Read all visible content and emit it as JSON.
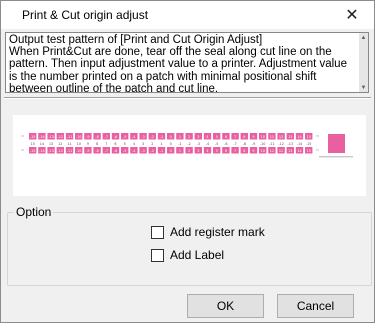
{
  "window": {
    "title": "Print & Cut origin adjust"
  },
  "description": {
    "text": "Output test pattern of [Print and Cut Origin Adjust]\nWhen Print&Cut are done, tear off the seal along cut line on the pattern. Then input adjustment value to a printer. Adjustment value is the number printed on a patch with minimal positional shift between outline of the patch and cut line."
  },
  "preview": {
    "row1_numbers": [
      "-15",
      "-14",
      "-13",
      "-12",
      "-11",
      "-10",
      "-9",
      "-8",
      "-7",
      "-6",
      "-5",
      "-4",
      "-3",
      "-2",
      "-1",
      "0",
      "1",
      "2",
      "3",
      "4",
      "5",
      "6",
      "7",
      "8",
      "9",
      "10",
      "11",
      "12",
      "13",
      "14",
      "15"
    ],
    "row2_numbers": [
      "-15",
      "-14",
      "-13",
      "-12",
      "-11",
      "-10",
      "-9",
      "-8",
      "-7",
      "-6",
      "-5",
      "-4",
      "-3",
      "-2",
      "-1",
      "0",
      "1",
      "2",
      "3",
      "4",
      "5",
      "6",
      "7",
      "8",
      "9",
      "10",
      "11",
      "12",
      "13",
      "14",
      "15"
    ],
    "mid_labels": [
      "15",
      "14",
      "13",
      "12",
      "11",
      "10",
      "9",
      "8",
      "7",
      "6",
      "5",
      "4",
      "3",
      "2",
      "1",
      "0",
      "-1",
      "-2",
      "-3",
      "-4",
      "-5",
      "-6",
      "-7",
      "-8",
      "-9",
      "-10",
      "-11",
      "-12",
      "-13",
      "-14",
      "-15"
    ],
    "patch_color": "#e8609f"
  },
  "option": {
    "group_label": "Option",
    "register_mark_label": "Add register mark",
    "add_label_label": "Add Label"
  },
  "buttons": {
    "ok_label": "OK",
    "cancel_label": "Cancel"
  }
}
